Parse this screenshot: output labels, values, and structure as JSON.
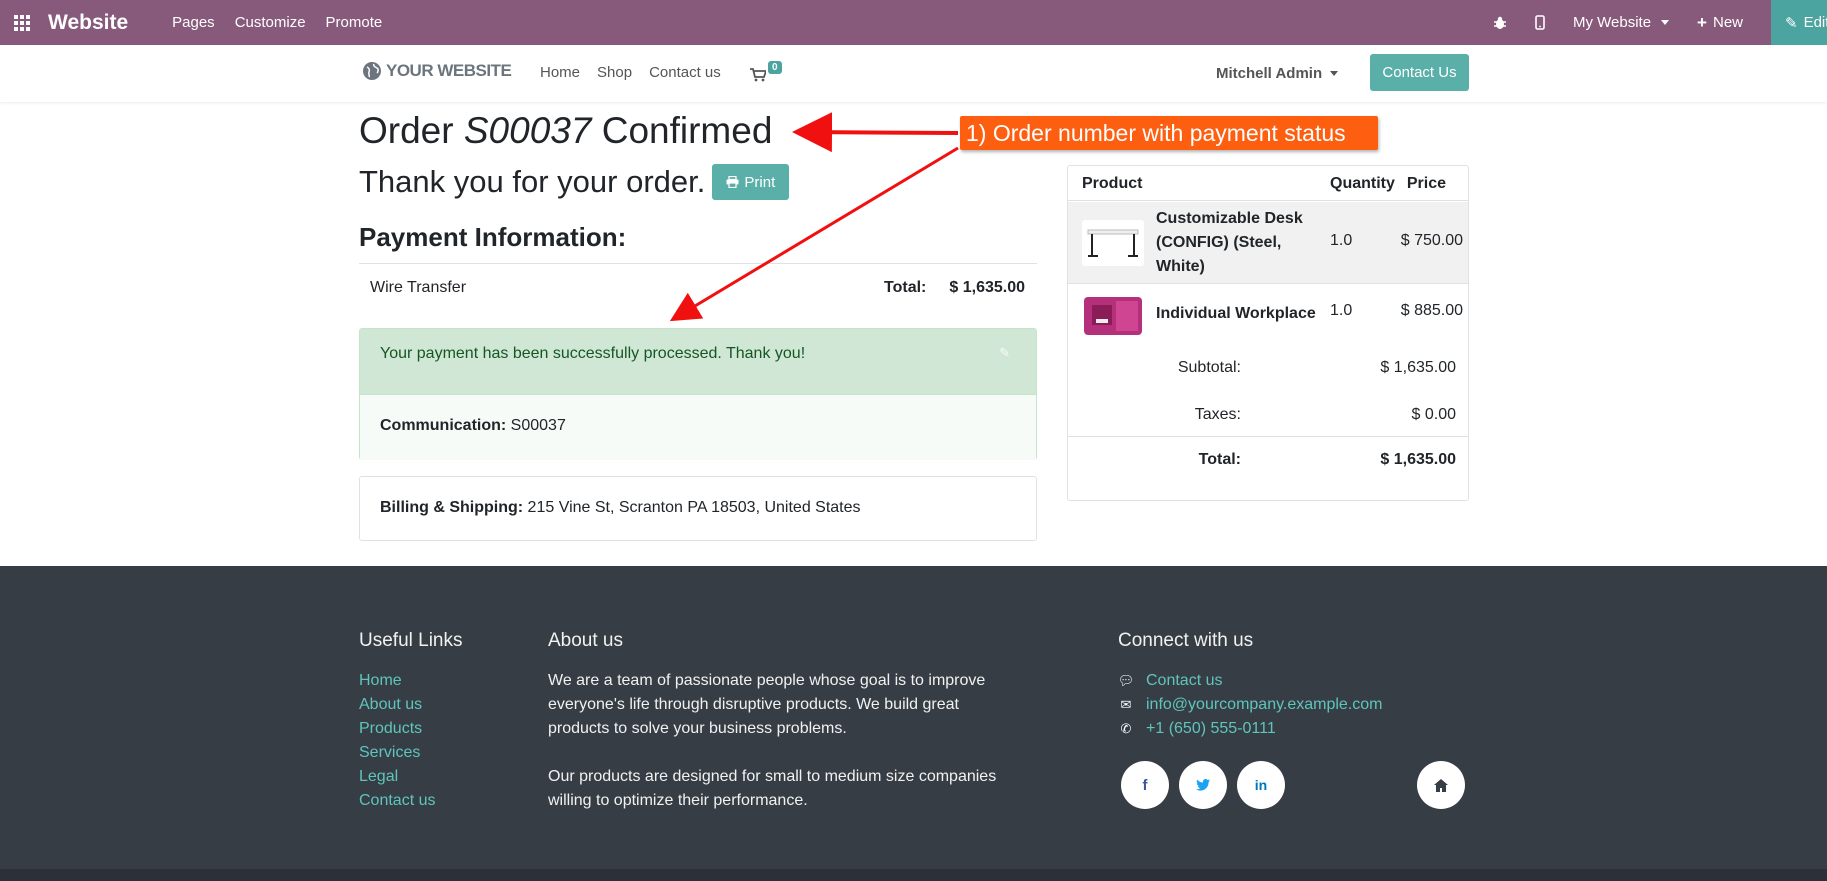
{
  "topbar": {
    "brand": "Website",
    "menu": [
      "Pages",
      "Customize",
      "Promote"
    ],
    "my_website": "My Website",
    "new_label": "New",
    "edit_label": "Edit"
  },
  "header": {
    "logo_text": "YOUR WEBSITE",
    "nav": [
      "Home",
      "Shop",
      "Contact us"
    ],
    "cart_count": "0",
    "user": "Mitchell Admin",
    "contact_button": "Contact Us"
  },
  "order": {
    "title_prefix": "Order",
    "order_number": "S00037",
    "title_suffix": "Confirmed",
    "thanks": "Thank you for your order.",
    "print_label": "Print",
    "payment_heading": "Payment Information:",
    "payment_method": "Wire Transfer",
    "total_label": "Total:",
    "total_value": "$ 1,635.00",
    "alert_message": "Your payment has been successfully processed. Thank you!",
    "communication_label": "Communication:",
    "communication_value": "S00037",
    "billing_label": "Billing & Shipping:",
    "billing_value": "215 Vine St, Scranton PA 18503, United States"
  },
  "cart_table": {
    "headers": [
      "Product",
      "Quantity",
      "Price"
    ],
    "rows": [
      {
        "name": "Customizable Desk (CONFIG) (Steel, White)",
        "qty": "1.0",
        "price": "$ 750.00"
      },
      {
        "name": "Individual Workplace",
        "qty": "1.0",
        "price": "$ 885.00"
      }
    ],
    "subtotal_label": "Subtotal:",
    "subtotal_value": "$ 1,635.00",
    "taxes_label": "Taxes:",
    "taxes_value": "$ 0.00",
    "total_label": "Total:",
    "total_value": "$ 1,635.00"
  },
  "annotation": {
    "text": "1) Order number with payment status",
    "color": "#fd5e0f",
    "arrow_color": "#f01010"
  },
  "footer": {
    "useful_links_heading": "Useful Links",
    "useful_links": [
      "Home",
      "About us",
      "Products",
      "Services",
      "Legal",
      "Contact us"
    ],
    "about_heading": "About us",
    "about_p1": "We are a team of passionate people whose goal is to improve everyone's life through disruptive products. We build great products to solve your business problems.",
    "about_p2": "Our products are designed for small to medium size companies willing to optimize their performance.",
    "connect_heading": "Connect with us",
    "connect_contact": "Contact us",
    "connect_email": "info@yourcompany.example.com",
    "connect_phone": "+1 (650) 555-0111"
  },
  "colors": {
    "topbar": "#875a7b",
    "accent": "#5ab0a8",
    "footer": "#373d45",
    "link": "#5ec5bd"
  }
}
